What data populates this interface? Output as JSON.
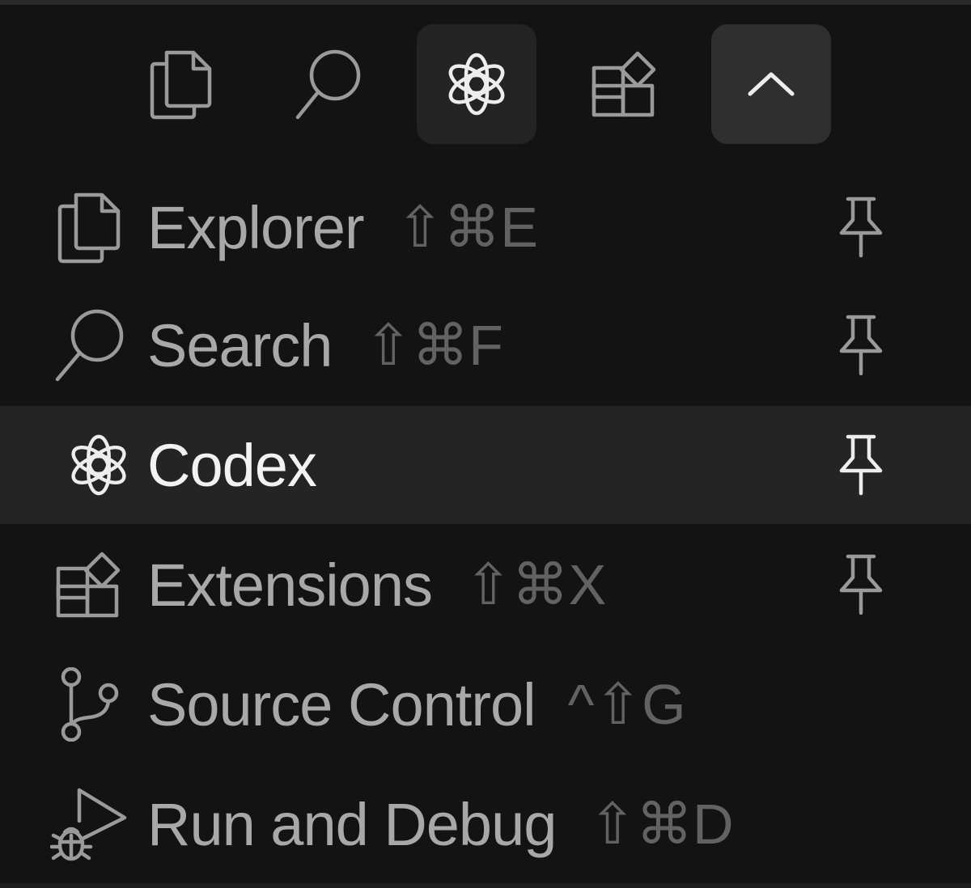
{
  "activity_bar": {
    "buttons": [
      {
        "icon": "files-icon",
        "state": "normal"
      },
      {
        "icon": "search-icon",
        "state": "normal"
      },
      {
        "icon": "codex-icon",
        "state": "active"
      },
      {
        "icon": "extensions-icon",
        "state": "normal"
      },
      {
        "icon": "chevron-up-icon",
        "state": "toggle"
      }
    ]
  },
  "menu": {
    "items": [
      {
        "label": "Explorer",
        "shortcut": "⇧⌘E",
        "icon": "files-icon",
        "pinned_icon": "pin-icon",
        "selected": false
      },
      {
        "label": "Search",
        "shortcut": "⇧⌘F",
        "icon": "search-icon",
        "pinned_icon": "pin-icon",
        "selected": false
      },
      {
        "label": "Codex",
        "shortcut": "",
        "icon": "codex-icon",
        "pinned_icon": "pin-icon",
        "selected": true
      },
      {
        "label": "Extensions",
        "shortcut": "⇧⌘X",
        "icon": "extensions-icon",
        "pinned_icon": "pin-icon",
        "selected": false
      },
      {
        "label": "Source Control",
        "shortcut": "^⇧G",
        "icon": "source-control-icon",
        "pinned_icon": "",
        "selected": false
      },
      {
        "label": "Run and Debug",
        "shortcut": "⇧⌘D",
        "icon": "run-debug-icon",
        "pinned_icon": "",
        "selected": false
      }
    ]
  },
  "colors": {
    "background": "#131313",
    "selected_row": "#242424",
    "label": "#a8a8a8",
    "label_selected": "#f2f2f2",
    "shortcut": "#626262",
    "icon": "#9a9a9a",
    "icon_active": "#ededed"
  }
}
